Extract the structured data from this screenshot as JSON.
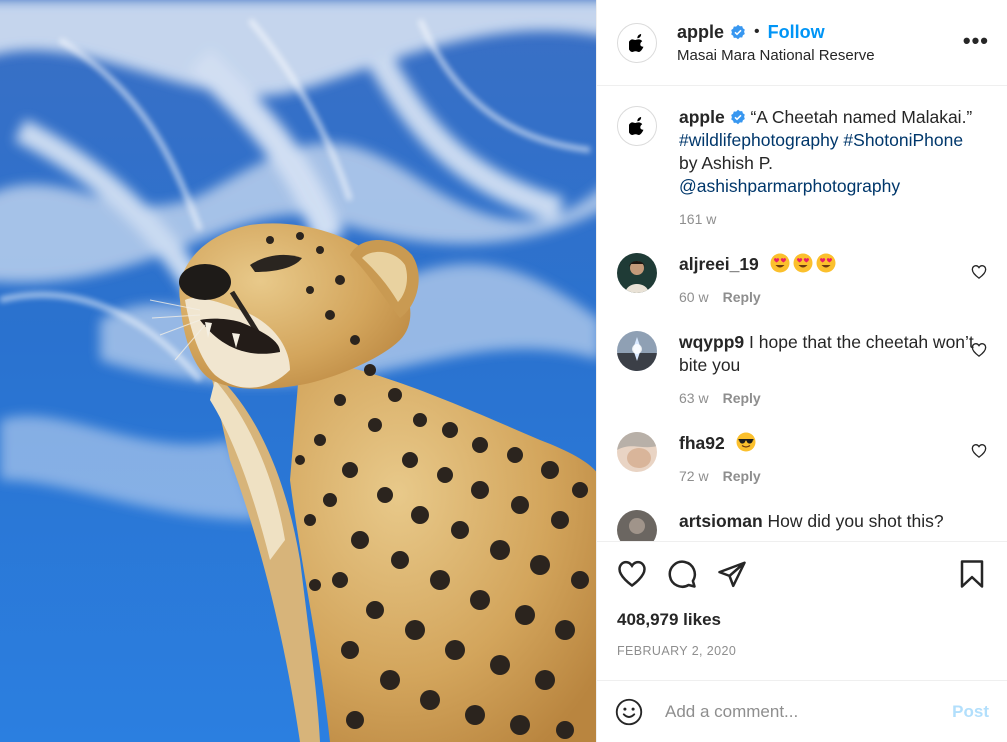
{
  "header": {
    "username": "apple",
    "separator": "•",
    "follow_label": "Follow",
    "location": "Masai Mara National Reserve",
    "more_label": "•••"
  },
  "caption": {
    "username": "apple",
    "text": "“A Cheetah named Malakai.”",
    "hashtags": "#wildlifephotography #ShotoniPhone",
    "credit": "by Ashish P.",
    "mention": "@ashishparmarphotography",
    "time": "161 w"
  },
  "comments": [
    {
      "username": "aljreei_19",
      "text": "",
      "emoji": [
        "heart-eyes-emoji",
        "heart-eyes-emoji",
        "heart-eyes-emoji"
      ],
      "time": "60 w",
      "reply_label": "Reply"
    },
    {
      "username": "wqypp9",
      "text": "I hope that the cheetah won’t bite you",
      "time": "63 w",
      "reply_label": "Reply"
    },
    {
      "username": "fha92",
      "text": "",
      "emoji": [
        "sunglasses-emoji"
      ],
      "time": "72 w",
      "reply_label": "Reply"
    },
    {
      "username": "artsioman",
      "text": "How did you shot this?"
    }
  ],
  "engagement": {
    "likes": "408,979 likes",
    "date": "FEBRUARY 2, 2020"
  },
  "add_comment": {
    "placeholder": "Add a comment...",
    "post_label": "Post"
  },
  "colors": {
    "accent": "#0095f6",
    "link": "#00376b",
    "muted": "#8e8e8e",
    "verified": "#3897f0",
    "post_disabled": "#b2dffc"
  },
  "icons": [
    "apple-logo-icon",
    "verified-badge-icon",
    "more-options-icon",
    "heart-icon",
    "comment-icon",
    "share-icon",
    "bookmark-icon",
    "emoji-smile-icon"
  ]
}
